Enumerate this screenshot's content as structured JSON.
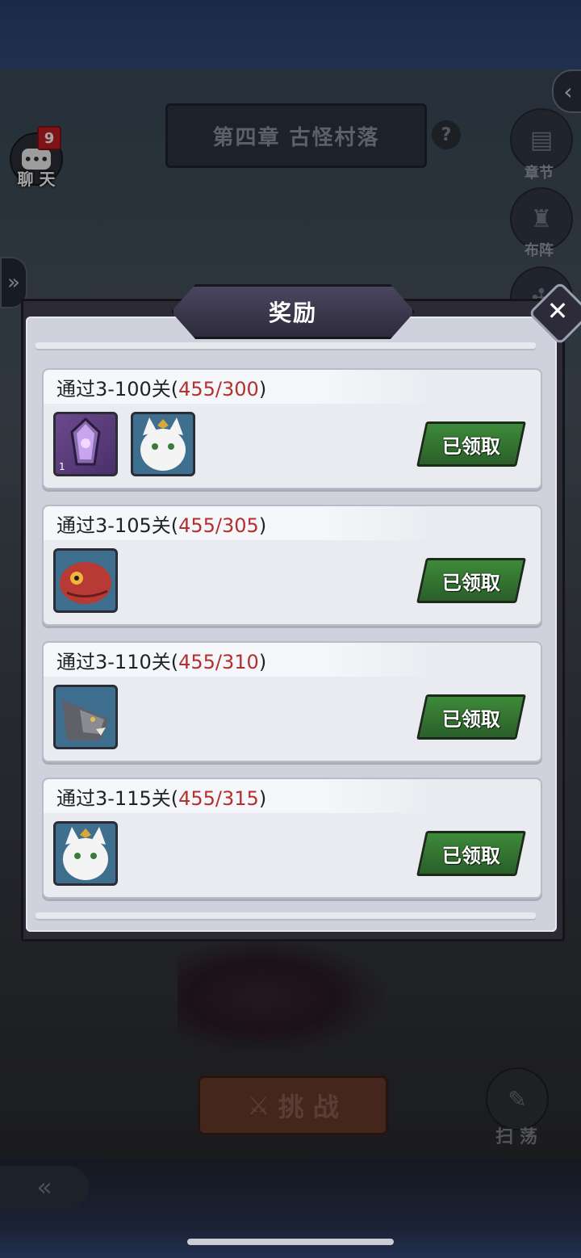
{
  "chapter": {
    "title": "第四章 古怪村落",
    "help": "?"
  },
  "side_menu": [
    {
      "label": "章节",
      "icon": "book-icon"
    },
    {
      "label": "布阵",
      "icon": "formation-icon"
    }
  ],
  "chat": {
    "label": "聊 天",
    "badge": "9"
  },
  "challenge": {
    "label": "挑 战"
  },
  "sweep": {
    "label": "扫 荡"
  },
  "modal": {
    "title": "奖励",
    "rewards": [
      {
        "prefix": "通过3-100关(",
        "progress": "455/300",
        "suffix": ")",
        "status": "已领取",
        "items": [
          {
            "icon": "purple-crystal-icon",
            "count": "1"
          },
          {
            "icon": "white-cat-portrait-icon"
          }
        ]
      },
      {
        "prefix": "通过3-105关(",
        "progress": "455/305",
        "suffix": ")",
        "status": "已领取",
        "items": [
          {
            "icon": "red-lizard-portrait-icon"
          }
        ]
      },
      {
        "prefix": "通过3-110关(",
        "progress": "455/310",
        "suffix": ")",
        "status": "已领取",
        "items": [
          {
            "icon": "grey-wolf-portrait-icon"
          }
        ]
      },
      {
        "prefix": "通过3-115关(",
        "progress": "455/315",
        "suffix": ")",
        "status": "已领取",
        "items": [
          {
            "icon": "white-cat-portrait-icon"
          }
        ]
      }
    ]
  }
}
